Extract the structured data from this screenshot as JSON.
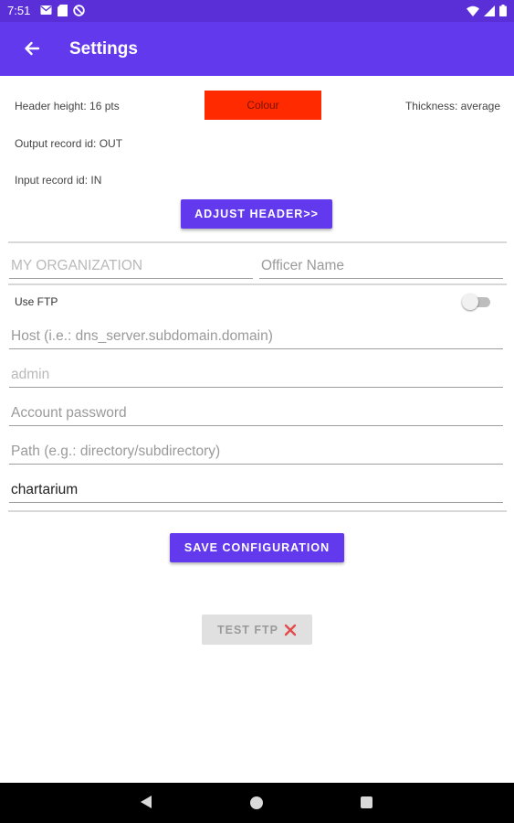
{
  "status_bar": {
    "time": "7:51",
    "icons": [
      "gmail-icon",
      "sd-card-icon",
      "sync-blocked-icon"
    ],
    "right_icons": [
      "wifi-icon",
      "signal-icon",
      "battery-icon"
    ]
  },
  "app_bar": {
    "title": "Settings",
    "back_icon": "arrow-back-icon",
    "color": "#6239ec"
  },
  "header_settings": {
    "header_height": "Header height: 16 pts",
    "colour_label": "Colour",
    "colour_value": "#ff2a00",
    "thickness": "Thickness: average",
    "output_record": "Output record id: OUT",
    "input_record": "Input record id: IN",
    "adjust_button": "ADJUST HEADER>>"
  },
  "organization": {
    "org_placeholder": "MY ORGANIZATION",
    "org_value": "",
    "officer_placeholder": "Officer Name",
    "officer_value": ""
  },
  "ftp": {
    "use_ftp_label": "Use FTP",
    "use_ftp_enabled": false,
    "host_placeholder": "Host (i.e.: dns_server.subdomain.domain)",
    "user_placeholder": "admin",
    "password_placeholder": "Account password",
    "path_placeholder": "Path (e.g.: directory/subdirectory)",
    "folder_value": "chartarium"
  },
  "actions": {
    "save_label": "SAVE CONFIGURATION",
    "test_label": "TEST FTP",
    "test_status_icon": "red-x-icon"
  },
  "nav_bar": {
    "buttons": [
      "nav-back-icon",
      "nav-home-icon",
      "nav-recents-icon"
    ]
  }
}
